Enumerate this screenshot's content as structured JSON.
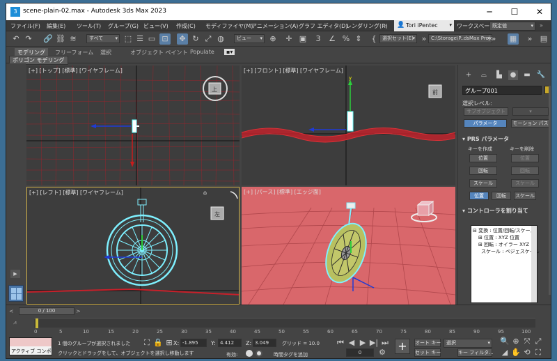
{
  "window": {
    "title": "scene-plain-02.max - Autodesk 3ds Max 2023",
    "app_icon": "3ds-max-icon"
  },
  "menu": [
    "ファイル(F)",
    "編集(E)",
    "ツール(T)",
    "グループ(G)",
    "ビュー(V)",
    "作成(C)",
    "モディファイヤ(M)",
    "アニメーション(A)",
    "グラフ エディタ(D)",
    "レンダリング(R)"
  ],
  "user": {
    "name": "Tori iPentec",
    "workspace_label": "ワークスペース:",
    "workspace_value": "既定値"
  },
  "toolbar": {
    "filter_value": "すべて",
    "refcoord_value": "ビュー",
    "selection_set": "選択セット(E)",
    "project_path": "C:\\Storage\\P..dsMax Project"
  },
  "ribbon": {
    "tabs": [
      "モデリング",
      "フリーフォーム",
      "選択",
      "オブジェクト ペイント",
      "Populate"
    ],
    "sub_label": "ポリゴン モデリング"
  },
  "viewports": {
    "top": "[+] [トップ] [標準] [ワイヤフレーム]",
    "front": "[+] [フロント] [標準] [ワイヤフレーム]",
    "left": "[+] [レフト] [標準] [ワイヤフレーム]",
    "persp": "[+] [パース] [標準] [エッジ面]",
    "cube_top": "上",
    "cube_front": "前",
    "cube_left": "左",
    "axis_y": "y"
  },
  "command_panel": {
    "object_name": "グループ001",
    "object_color": "#c8a82a",
    "selection_level_label": "選択レベル:",
    "sub_object_button": "サブオブジェクト",
    "parameters_button": "パラメータ",
    "motion_path_button": "モーション パス",
    "prs_title": "PRS パラメータ",
    "create_key_label": "キーを作成",
    "delete_key_label": "キーを削除",
    "position": "位置",
    "rotation": "回転",
    "scale": "スケール",
    "controllers_title": "コントローラを割り当て",
    "tree": [
      "⊟ 変換 : 位置/回転/スケール",
      "⊞ 位置 : XYZ 位置",
      "⊞ 回転 : オイラー XYZ",
      "スケール : ベジェスケール"
    ]
  },
  "timeline": {
    "frame_display": "0 / 100",
    "ticks": [
      "0",
      "5",
      "10",
      "15",
      "20",
      "25",
      "30",
      "35",
      "40",
      "45",
      "50",
      "55",
      "60",
      "65",
      "70",
      "75",
      "80",
      "85",
      "90",
      "95",
      "100"
    ]
  },
  "status": {
    "maxscript_label": "アクティブ コンポ",
    "selection_message": "1 個のグループが選択されました",
    "prompt_message": "クリックとドラッグをして、オブジェクトを選択し移動します",
    "x_label": "X:",
    "x_value": "-1.895",
    "y_label": "Y:",
    "y_value": "4.412",
    "z_label": "Z:",
    "z_value": "3.049",
    "grid": "グリッド = 10.0",
    "enabled_label": "有効:",
    "add_time_tag": "時間タグを追加",
    "auto_key": "オート キー",
    "set_key": "セット キー",
    "selected_dropdown": "選択",
    "key_filter": "キー フィルタ...",
    "current_frame": "0"
  },
  "colors": {
    "accent_blue": "#5585bd",
    "viewport_bg": "#3d3d3d",
    "persp_bg": "#d9676b",
    "wire_red": "#c8202a",
    "wheel_cyan": "#7ef0ff",
    "active_border": "#d4b44a"
  }
}
